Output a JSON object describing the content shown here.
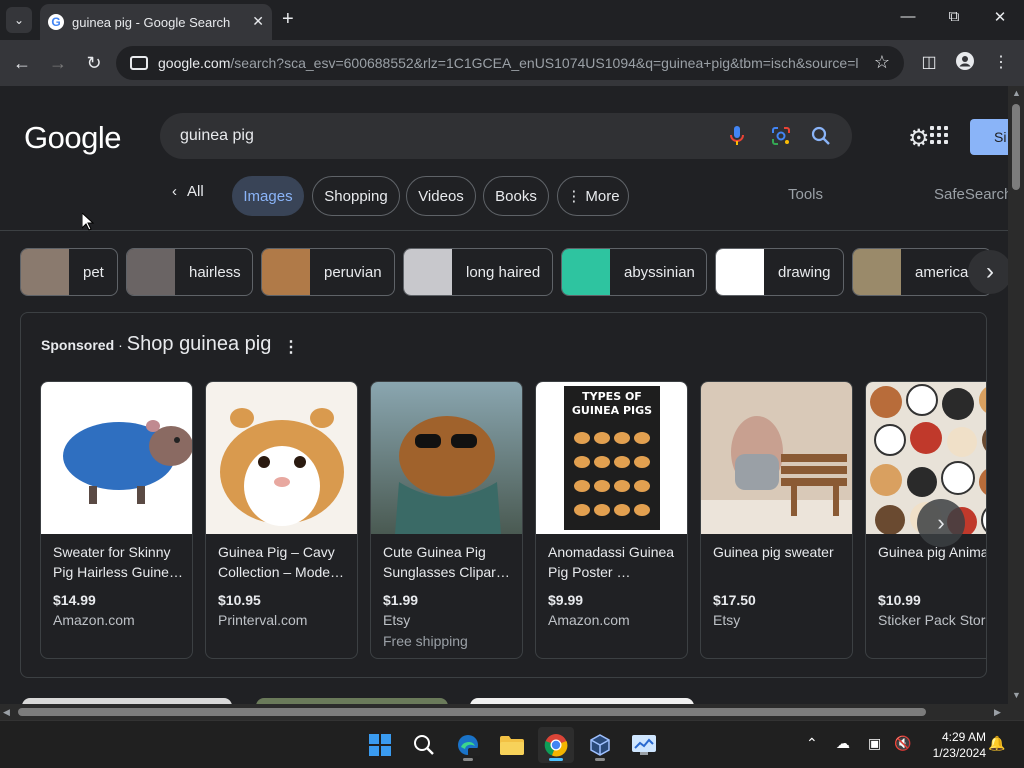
{
  "browser": {
    "tab_title": "guinea pig - Google Search",
    "url_host": "google.com",
    "url_rest": "/search?sca_esv=600688552&rlz=1C1GCEA_enUS1074US1094&q=guinea+pig&tbm=isch&source=l...",
    "close_glyph": "✕",
    "new_tab_glyph": "+"
  },
  "header": {
    "logo": "Google",
    "query": "guinea pig",
    "signin_label": "Si"
  },
  "tabs": {
    "back_all": "All",
    "images": "Images",
    "shopping": "Shopping",
    "videos": "Videos",
    "books": "Books",
    "more": "More",
    "tools": "Tools",
    "safesearch": "SafeSearch"
  },
  "chips": [
    {
      "label": "pet",
      "color": "#8a7a6e"
    },
    {
      "label": "hairless",
      "color": "#6a6464"
    },
    {
      "label": "peruvian",
      "color": "#b07a48"
    },
    {
      "label": "long haired",
      "color": "#c8c8cc"
    },
    {
      "label": "abyssinian",
      "color": "#2ec4a0"
    },
    {
      "label": "drawing",
      "color": "#ffffff"
    },
    {
      "label": "american",
      "color": "#9a8a6a"
    }
  ],
  "shopping": {
    "sponsored": "Sponsored",
    "separator": "·",
    "title": "Shop guinea pig",
    "products": [
      {
        "title": "Sweater for Skinny Pig Hairless Guine…",
        "price": "$14.99",
        "store": "Amazon.com",
        "shipping": "",
        "bg": "#ffffff",
        "accent": "#2f6fc0"
      },
      {
        "title": "Guinea Pig – Cavy Collection – Mode…",
        "price": "$10.95",
        "store": "Printerval.com",
        "shipping": "",
        "bg": "#f6f2ec",
        "accent": "#d99a4e"
      },
      {
        "title": "Cute Guinea Pig Sunglasses Clipar…",
        "price": "$1.99",
        "store": "Etsy",
        "shipping": "Free shipping",
        "bg": "#6f8a8a",
        "accent": "#a0622c"
      },
      {
        "title": "Anomadassi Guinea Pig Poster …",
        "price": "$9.99",
        "store": "Amazon.com",
        "shipping": "",
        "bg": "#ffffff",
        "accent": "#1e1e1e",
        "poster_text": "TYPES OF GUINEA PIGS"
      },
      {
        "title": "Guinea pig sweater",
        "price": "$17.50",
        "store": "Etsy",
        "shipping": "",
        "bg": "#d9c9b8",
        "accent": "#8a5a34"
      },
      {
        "title": "Guinea pig Anima Waterproof Carto",
        "price": "$10.99",
        "store": "Sticker Pack Store",
        "shipping": "",
        "bg": "#e8e2d8",
        "accent": "#b86c3a"
      }
    ]
  },
  "taskbar": {
    "time": "4:29 AM",
    "date": "1/23/2024"
  }
}
